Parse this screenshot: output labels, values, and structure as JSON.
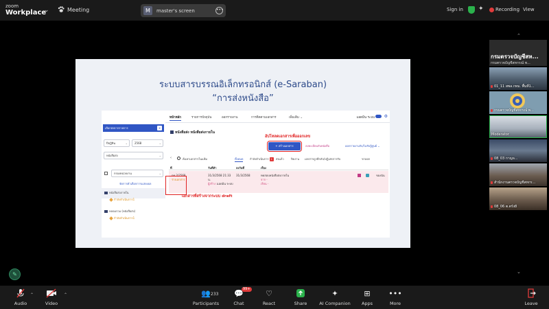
{
  "topbar": {
    "brand_line1": "zoom",
    "brand_line2": "Workplace",
    "meeting_label": "Meeting",
    "screen_badge_letter": "M",
    "screen_label": "master's screen",
    "sign_in": "Sign in",
    "recording": "Recording",
    "view": "View"
  },
  "slide": {
    "title": "ระบบสารบรรณอิเล็กทรอนิกส์ (e-Saraban)",
    "subtitle": "“การส่งหนังสือ”",
    "app": {
      "nav_tabs": [
        "หน้าหลัก",
        "รายการปัจจุบัน",
        "ออกรายงาน",
        "การติดตามเอกสาร",
        "เพิ่มเติม ⌄"
      ],
      "user_name": "แอดมิน ระบบ",
      "sidebar": {
        "header": "เลือกส่งจากรายการ",
        "header_btn": "✕",
        "year_select": "ปีปฏิทิน",
        "year_value": "2568",
        "doc_type_select": "หนังสือส่ง",
        "filter_select": "กรองหน่วยงาน",
        "filter_link": "จัดการตัวเลือกการแสดงผล",
        "section1": "หนังสือส่งภายใน",
        "section1_item": "กำลังดำเนินการ1",
        "section2": "หลอมรวม (หนังสือส่ง)",
        "section2_item": "กำลังดำเนินการ1"
      },
      "main": {
        "title": "หนังสือส่ง หนังสือส่งภายใน",
        "annotation_create": "อัปโหลดเอกสารเพื่อออกเลข",
        "create_button": "+ สร้างเอกสาร",
        "link_receive": "ลงทะเบียนรับหนังสือ",
        "link_report": "ออกรายงานรับ/ไม่รับรู้ศูนย์ ⌄",
        "back": "‹",
        "search_label": "ค้นหาเอกสารในแฟ้ม",
        "subtabs": [
          "ทั้งหมด",
          "กำลังดำเนินการ",
          "ส่งแล้ว",
          "ปิดงาน",
          "เอกสารถูกตีกลับ/ปฏิเสธการรับ",
          "ขาออก"
        ],
        "subtab_badge": "1",
        "columns": [
          "ที่",
          "วันที่ทำ",
          "ลงวันที่",
          "เรื่อง"
        ],
        "row": {
          "doc_no": "กท 2/2568",
          "status": "ร่างเอกสาร",
          "date_made": "31/3/2568 21:33",
          "date_made_sub": "น.",
          "creator_label": "ผู้สร้าง :",
          "creator": "แอดมิน ระบบ",
          "date_dated": "31/3/2568",
          "subject": "ทดสอบหนังสือส่งภายใน",
          "subject_from": "จาก -",
          "subject_to": "เรียน -",
          "action": "ของฉัน"
        },
        "annotation_draft": "เอกสารที่สร้างจากระบบ draft"
      }
    }
  },
  "participants": {
    "header_big": "กรมตรวจบัญชีสห...",
    "header_small": "กรมตรวจบัญชีสหกรณ์ พ...",
    "tiles": [
      {
        "label": "01_11 สพล.กทม. พื้นที่1..."
      },
      {
        "label": "กรมตรวจบัญชีสหกรณ์ พ..."
      },
      {
        "label": "Moderator"
      },
      {
        "label": "08_03 กาญจ..."
      },
      {
        "label": "สำนักงานตรวจบัญชีสหกร..."
      },
      {
        "label": "08_06 ต.ตรัง8"
      }
    ]
  },
  "toolbar": {
    "audio": "Audio",
    "video": "Video",
    "participants": "Participants",
    "participants_count": "233",
    "chat": "Chat",
    "chat_badge": "99+",
    "react": "React",
    "share": "Share",
    "ai": "AI Companion",
    "apps": "Apps",
    "more": "More",
    "leave": "Leave"
  },
  "colors": {
    "accent": "#3056c4",
    "annotation_red": "#e02020",
    "share_green": "#2bb24c",
    "record_red": "#e03b3b"
  }
}
